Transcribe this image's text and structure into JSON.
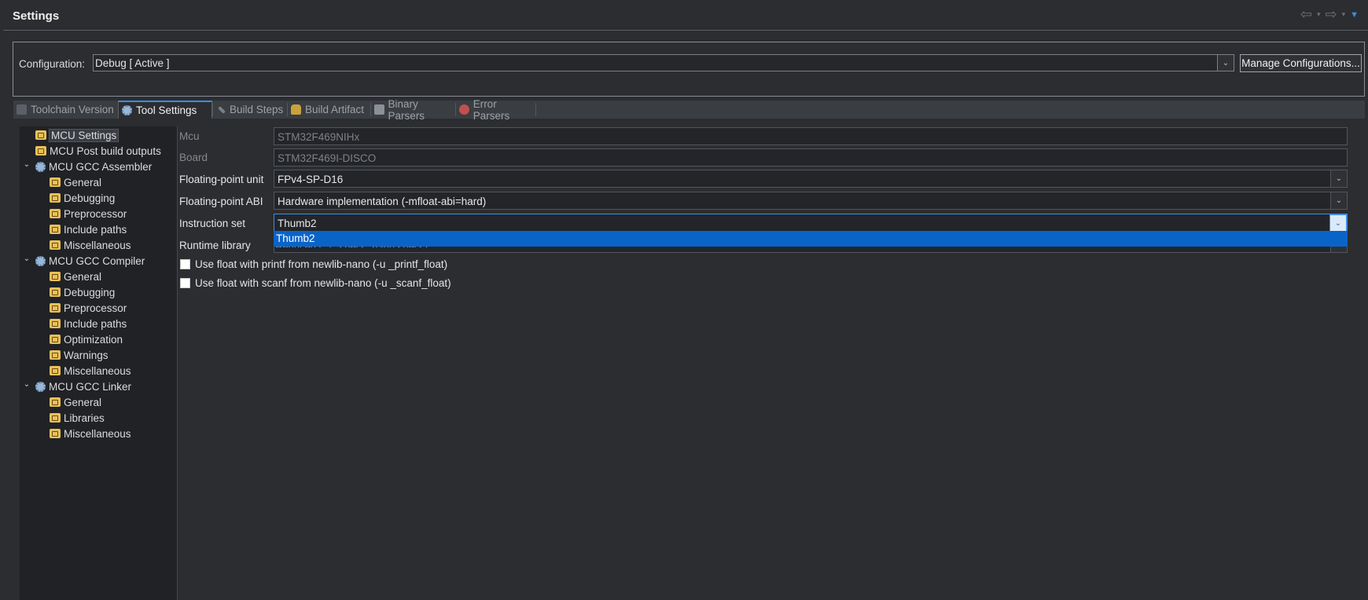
{
  "window": {
    "title": "Settings"
  },
  "configuration": {
    "label": "Configuration:",
    "value": "Debug  [ Active ]",
    "manage_button": "Manage Configurations..."
  },
  "tabs": [
    {
      "label": "Toolchain Version",
      "active": false
    },
    {
      "label": "Tool Settings",
      "active": true
    },
    {
      "label": "Build Steps",
      "active": false
    },
    {
      "label": "Build Artifact",
      "active": false
    },
    {
      "label": "Binary Parsers",
      "active": false
    },
    {
      "label": "Error Parsers",
      "active": false
    }
  ],
  "tree": [
    {
      "label": "MCU Settings",
      "icon": "folder-icon",
      "selected": true
    },
    {
      "label": "MCU Post build outputs",
      "icon": "folder-icon"
    },
    {
      "label": "MCU GCC Assembler",
      "icon": "gear-icon",
      "expanded": true
    },
    {
      "label": "General",
      "icon": "folder-icon"
    },
    {
      "label": "Debugging",
      "icon": "folder-icon"
    },
    {
      "label": "Preprocessor",
      "icon": "folder-icon"
    },
    {
      "label": "Include paths",
      "icon": "folder-icon"
    },
    {
      "label": "Miscellaneous",
      "icon": "folder-icon"
    },
    {
      "label": "MCU GCC Compiler",
      "icon": "gear-icon",
      "expanded": true
    },
    {
      "label": "General",
      "icon": "folder-icon"
    },
    {
      "label": "Debugging",
      "icon": "folder-icon"
    },
    {
      "label": "Preprocessor",
      "icon": "folder-icon"
    },
    {
      "label": "Include paths",
      "icon": "folder-icon"
    },
    {
      "label": "Optimization",
      "icon": "folder-icon"
    },
    {
      "label": "Warnings",
      "icon": "folder-icon"
    },
    {
      "label": "Miscellaneous",
      "icon": "folder-icon"
    },
    {
      "label": "MCU GCC Linker",
      "icon": "gear-icon",
      "expanded": true
    },
    {
      "label": "General",
      "icon": "folder-icon"
    },
    {
      "label": "Libraries",
      "icon": "folder-icon"
    },
    {
      "label": "Miscellaneous",
      "icon": "folder-icon"
    }
  ],
  "fields": {
    "mcu": {
      "label": "Mcu",
      "value": "STM32F469NIHx"
    },
    "board": {
      "label": "Board",
      "value": "STM32F469I-DISCO"
    },
    "fpu": {
      "label": "Floating-point unit",
      "value": "FPv4-SP-D16"
    },
    "fpabi": {
      "label": "Floating-point ABI",
      "value": "Hardware implementation (-mfloat-abi=hard)"
    },
    "iset": {
      "label": "Instruction set",
      "value": "Thumb2",
      "options": [
        "Thumb2"
      ]
    },
    "runtime": {
      "label": "Runtime library",
      "value": "Reduced C (--specs=nano.specs)"
    }
  },
  "checkboxes": [
    {
      "label": "Use float with printf from newlib-nano (-u _printf_float)",
      "checked": false
    },
    {
      "label": "Use float with scanf from newlib-nano (-u _scanf_float)",
      "checked": false
    }
  ],
  "colors": {
    "accent": "#3d8de0",
    "selection": "#0a64c8",
    "background": "#2b2d31"
  }
}
